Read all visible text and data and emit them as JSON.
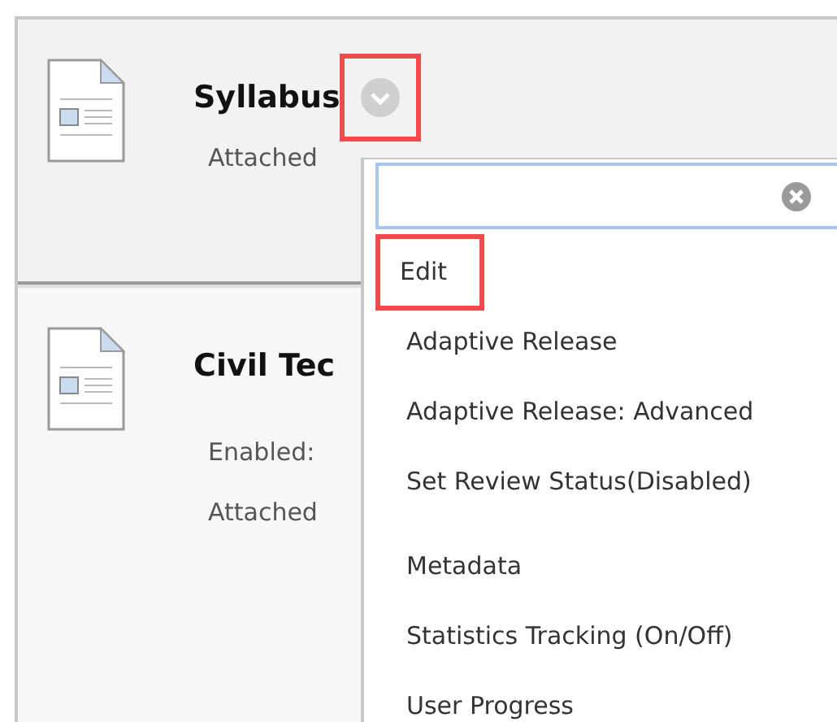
{
  "items": [
    {
      "title": "Syllabus",
      "menu_button": {
        "highlighted": true
      },
      "details": [
        "Attached"
      ]
    },
    {
      "title": "Civil Tec",
      "details": [
        "Enabled:",
        "Attached"
      ]
    }
  ],
  "menu": {
    "groups": [
      [
        {
          "label": "Edit",
          "highlighted": true
        },
        {
          "label": "Adaptive Release",
          "highlighted": false
        },
        {
          "label": "Adaptive Release: Advanced",
          "highlighted": false
        },
        {
          "label": "Set Review Status(Disabled)",
          "highlighted": false
        }
      ],
      [
        {
          "label": "Metadata",
          "highlighted": false
        },
        {
          "label": "Statistics Tracking (On/Off)",
          "highlighted": false
        },
        {
          "label": "User Progress",
          "highlighted": false
        }
      ]
    ]
  }
}
